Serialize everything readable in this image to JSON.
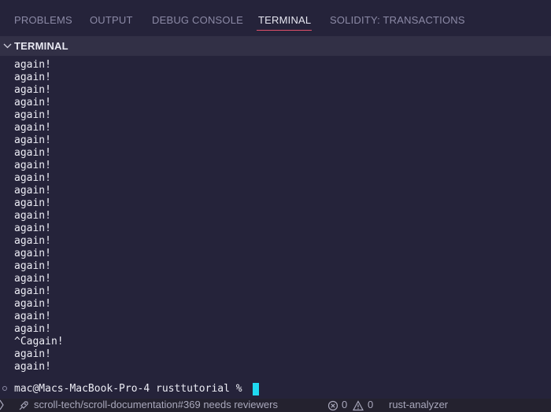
{
  "tabs": [
    {
      "label": "PROBLEMS",
      "active": false
    },
    {
      "label": "OUTPUT",
      "active": false
    },
    {
      "label": "DEBUG CONSOLE",
      "active": false
    },
    {
      "label": "TERMINAL",
      "active": true
    },
    {
      "label": "SOLIDITY: TRANSACTIONS",
      "active": false
    }
  ],
  "section": {
    "title": "TERMINAL",
    "icon": "chevron-down-icon"
  },
  "terminal": {
    "lines": [
      "again!",
      "again!",
      "again!",
      "again!",
      "again!",
      "again!",
      "again!",
      "again!",
      "again!",
      "again!",
      "again!",
      "again!",
      "again!",
      "again!",
      "again!",
      "again!",
      "again!",
      "again!",
      "again!",
      "again!",
      "again!",
      "again!",
      "^Cagain!",
      "again!",
      "again!"
    ],
    "prompt": "mac@Macs-MacBook-Pro-4 rusttutorial %"
  },
  "statusbar": {
    "branch_text": "scroll-tech/scroll-documentation#369 needs reviewers",
    "errors": "0",
    "warnings": "0",
    "analyzer": "rust-analyzer",
    "icons": [
      "rocket-icon",
      "error-icon",
      "warning-icon"
    ]
  },
  "colors": {
    "background": "#25233a",
    "section_header": "#323046",
    "active_tab_underline": "#e0506a",
    "cursor": "#1fd9f0",
    "text": "#ececf4",
    "muted_text": "#8c8aa6"
  }
}
